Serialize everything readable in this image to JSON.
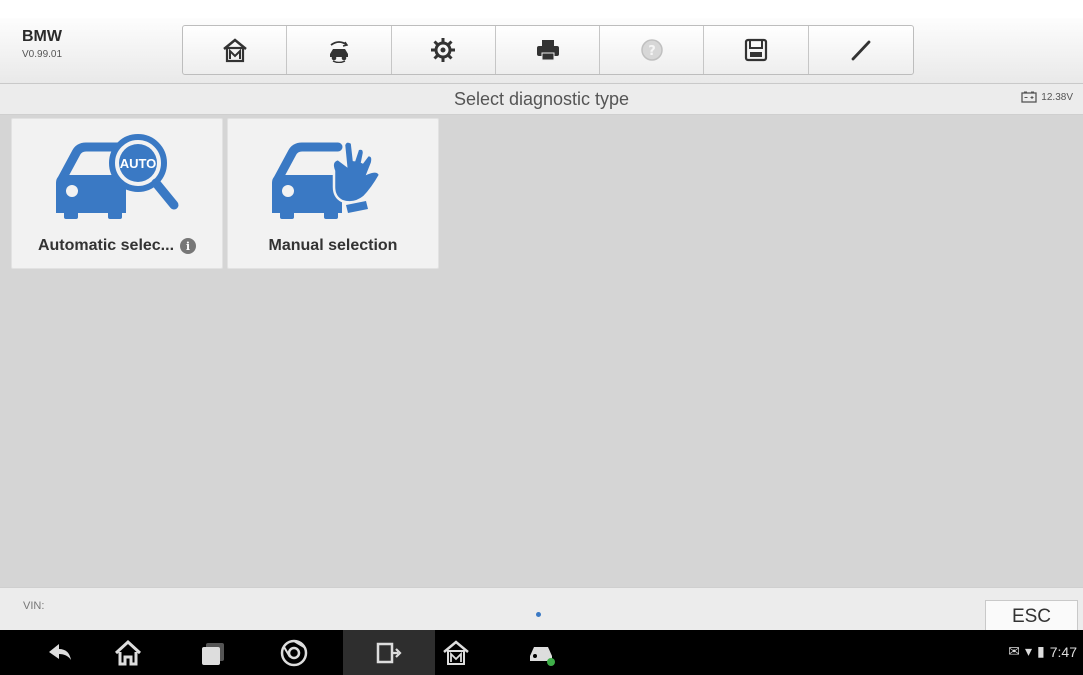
{
  "app": {
    "name": "BMW",
    "version": "V0.99.01"
  },
  "toolbar": {
    "items": [
      {
        "icon": "home-icon"
      },
      {
        "icon": "vehicle-swap-icon"
      },
      {
        "icon": "settings-icon"
      },
      {
        "icon": "print-icon"
      },
      {
        "icon": "help-icon"
      },
      {
        "icon": "save-icon"
      },
      {
        "icon": "edit-icon"
      }
    ]
  },
  "header": {
    "title": "Select diagnostic type",
    "battery_voltage": "12.38V"
  },
  "tiles": [
    {
      "label": "Automatic selec...",
      "icon": "car-auto-search-icon",
      "has_info": true
    },
    {
      "label": "Manual selection",
      "icon": "car-manual-hand-icon",
      "has_info": false
    }
  ],
  "auto_badge": "AUTO",
  "info_glyph": "i",
  "bottom": {
    "vin_label": "VIN:",
    "esc_label": "ESC"
  },
  "system": {
    "time": "7:47"
  },
  "colors": {
    "accent_blue": "#3a79c4",
    "tile_bg": "#f2f2f2",
    "content_bg": "#d5d5d5",
    "navbar_bg": "#000000"
  }
}
